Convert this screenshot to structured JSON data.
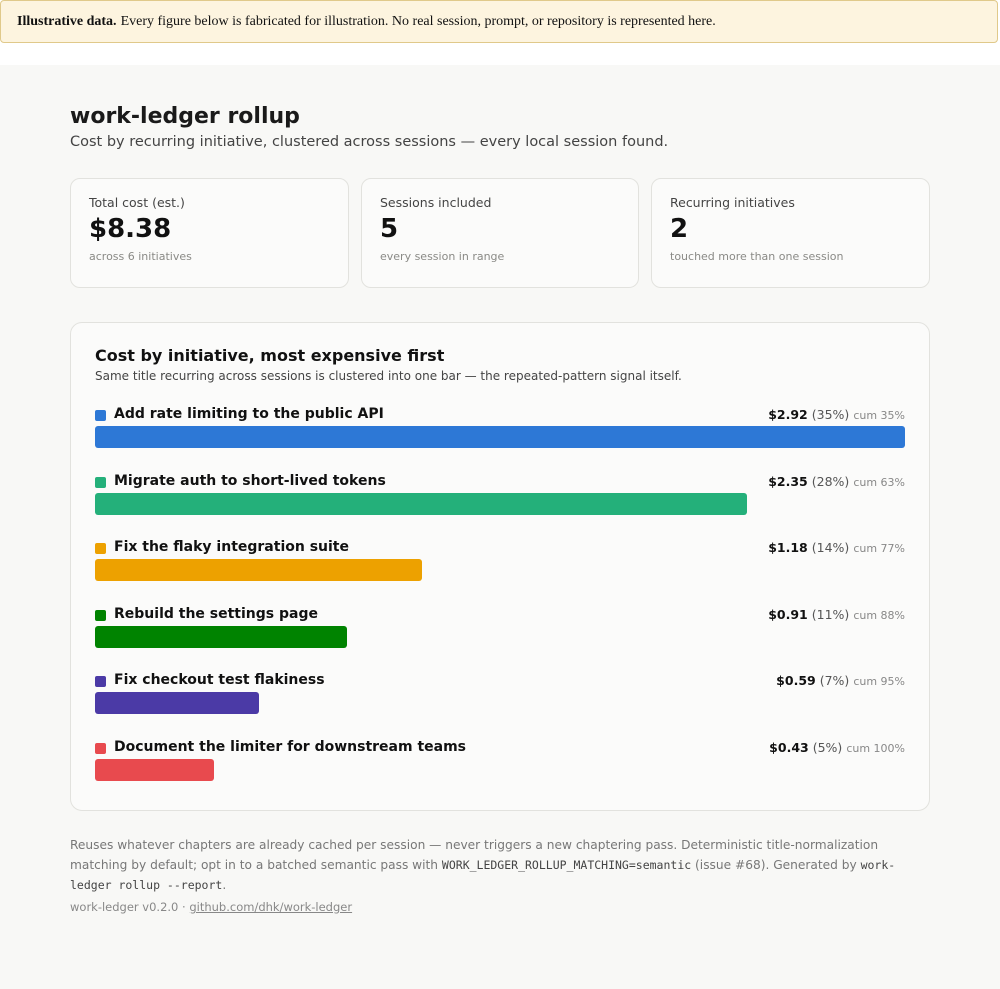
{
  "notice": {
    "bold": "Illustrative data.",
    "text": "Every figure below is fabricated for illustration. No real session, prompt, or repository is represented here."
  },
  "header": {
    "title": "work-ledger rollup",
    "subtitle": "Cost by recurring initiative, clustered across sessions — every local session found."
  },
  "kpis": [
    {
      "label": "Total cost (est.)",
      "value": "$8.38",
      "sub": "across 6 initiatives"
    },
    {
      "label": "Sessions included",
      "value": "5",
      "sub": "every session in range"
    },
    {
      "label": "Recurring initiatives",
      "value": "2",
      "sub": "touched more than one session"
    }
  ],
  "chart": {
    "title": "Cost by initiative, most expensive first",
    "subtitle": "Same title recurring across sessions is clustered into one bar — the repeated-pattern signal itself."
  },
  "chart_data": {
    "type": "bar",
    "orientation": "horizontal",
    "title": "Cost by initiative, most expensive first",
    "categories": [
      "Add rate limiting to the public API",
      "Migrate auth to short-lived tokens",
      "Fix the flaky integration suite",
      "Rebuild the settings page",
      "Fix checkout test flakiness",
      "Document the limiter for downstream teams"
    ],
    "values": [
      2.92,
      2.35,
      1.18,
      0.91,
      0.59,
      0.43
    ],
    "amount_labels": [
      "$2.92",
      "$2.35",
      "$1.18",
      "$0.91",
      "$0.59",
      "$0.43"
    ],
    "percent_labels": [
      "(35%)",
      "(28%)",
      "(14%)",
      "(11%)",
      "(7%)",
      "(5%)"
    ],
    "cumulative_labels": [
      "cum 35%",
      "cum 63%",
      "cum 77%",
      "cum 88%",
      "cum 95%",
      "cum 100%"
    ],
    "colors": [
      "#2d78d6",
      "#24b07a",
      "#eda100",
      "#008300",
      "#4b3aa6",
      "#e84a4e"
    ]
  },
  "footnote": {
    "text1": "Reuses whatever chapters are already cached per session — never triggers a new chaptering pass. Deterministic title-normalization matching by default; opt in to a batched semantic pass with",
    "code1": "WORK_LEDGER_ROLLUP_MATCHING=semantic",
    "text2": "(issue #68). Generated by",
    "code2": "work-ledger rollup --report",
    "text3": "."
  },
  "footer": {
    "version": "work-ledger v0.2.0 ·",
    "link": "github.com/dhk/work-ledger"
  }
}
